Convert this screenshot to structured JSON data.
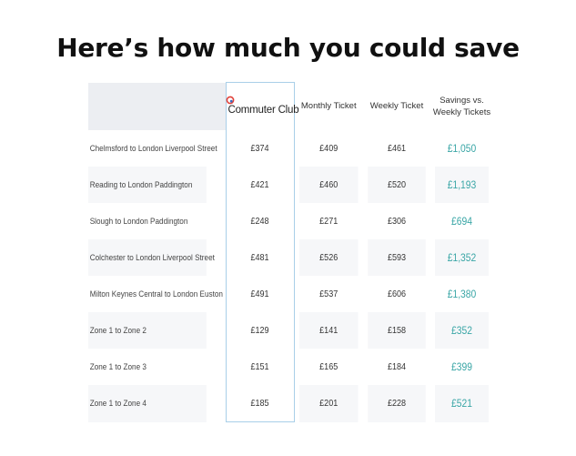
{
  "title": "Here’s how much you could save",
  "table": {
    "headers": {
      "route": "",
      "commuter_club": "Commuter Club",
      "monthly": "Monthly Ticket",
      "weekly": "Weekly Ticket",
      "savings": "Savings vs. Weekly Tickets"
    },
    "rows": [
      {
        "route": "Chelmsford to London Liverpool Street",
        "commuter_club": "£374",
        "monthly": "£409",
        "weekly": "£461",
        "savings": "£1,050"
      },
      {
        "route": "Reading to London Paddington",
        "commuter_club": "£421",
        "monthly": "£460",
        "weekly": "£520",
        "savings": "£1,193"
      },
      {
        "route": "Slough to London Paddington",
        "commuter_club": "£248",
        "monthly": "£271",
        "weekly": "£306",
        "savings": "£694"
      },
      {
        "route": "Colchester to London Liverpool Street",
        "commuter_club": "£481",
        "monthly": "£526",
        "weekly": "£593",
        "savings": "£1,352"
      },
      {
        "route": "Milton Keynes Central to London Euston",
        "commuter_club": "£491",
        "monthly": "£537",
        "weekly": "£606",
        "savings": "£1,380"
      },
      {
        "route": "Zone 1 to Zone 2",
        "commuter_club": "£129",
        "monthly": "£141",
        "weekly": "£158",
        "savings": "£352"
      },
      {
        "route": "Zone 1 to Zone 3",
        "commuter_club": "£151",
        "monthly": "£165",
        "weekly": "£184",
        "savings": "£399"
      },
      {
        "route": "Zone 1 to Zone 4",
        "commuter_club": "£185",
        "monthly": "£201",
        "weekly": "£228",
        "savings": "£521"
      }
    ]
  },
  "icons": {
    "brand": "commuter-club-logo-icon"
  },
  "colors": {
    "savings_accent": "#3aa6a6",
    "highlight_border": "#a9cfe8",
    "header_bg": "#eceef2",
    "logo_red": "#e0413a",
    "logo_blue": "#3b6fc4"
  }
}
